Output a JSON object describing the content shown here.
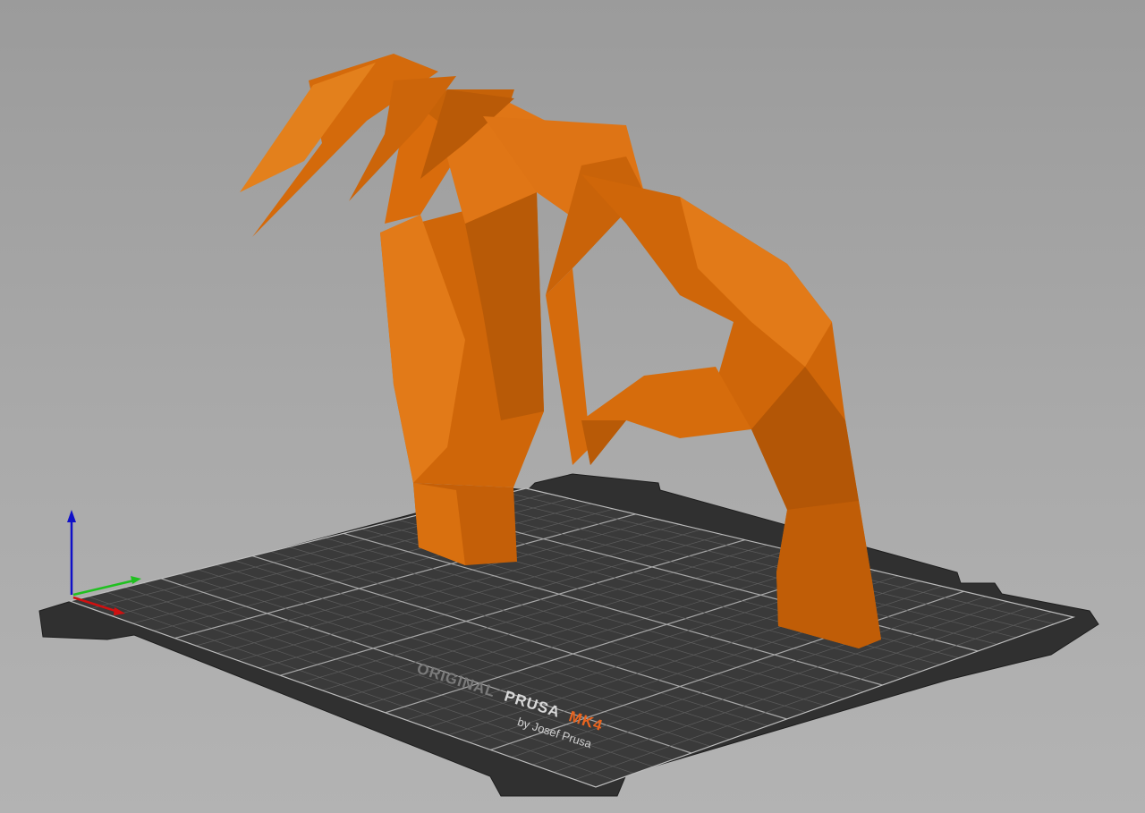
{
  "app": {
    "view": "3D Plater viewport"
  },
  "bed": {
    "brand_prefix": "ORIGINAL",
    "brand_name": "PRUSA",
    "model": "MK4",
    "byline": "by Josef Prusa",
    "bed_color": "#2e2e2e",
    "grid_color": "#6a6a6a",
    "accent_color": "#e8641f"
  },
  "model": {
    "name": "claw-hands",
    "color": "#d96c0c",
    "color_dark": "#a24f07",
    "color_light": "#f08a2a"
  },
  "axes": {
    "x_color": "#d01010",
    "y_color": "#20c020",
    "z_color": "#1010c8"
  }
}
